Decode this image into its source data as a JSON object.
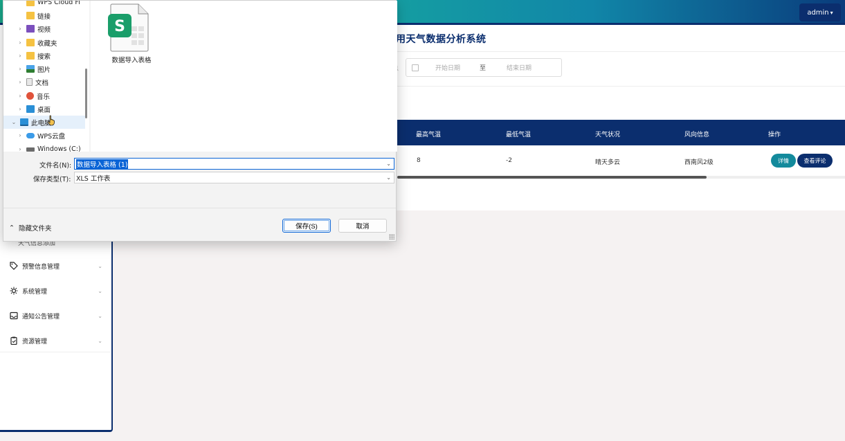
{
  "app": {
    "title": "用天气数据分析系统",
    "user_menu": "admin"
  },
  "sidebar": {
    "partial_item": "天气信息添加",
    "items": [
      {
        "label": "预警信息管理",
        "icon": "tag-icon"
      },
      {
        "label": "系统管理",
        "icon": "gear-icon"
      },
      {
        "label": "通知公告管理",
        "icon": "inbox-icon"
      },
      {
        "label": "资源管理",
        "icon": "clipboard-icon"
      }
    ]
  },
  "filter": {
    "prefix_fragment": "息",
    "start_placeholder": "开始日期",
    "separator": "至",
    "end_placeholder": "结束日期"
  },
  "table": {
    "headers": [
      "最高气温",
      "最低气温",
      "天气状况",
      "风向信息",
      "操作"
    ],
    "rows": [
      {
        "max_temp": "8",
        "min_temp": "-2",
        "condition": "晴天多云",
        "wind": "西南风2级",
        "detail_btn": "详情",
        "review_btn": "查看评论"
      }
    ]
  },
  "dialog": {
    "nav_items": [
      {
        "label": "WPS Cloud Fi",
        "icon": "folder-icon",
        "expandable": false
      },
      {
        "label": "链接",
        "icon": "folder-icon",
        "expandable": false
      },
      {
        "label": "视频",
        "icon": "video-icon",
        "expandable": true
      },
      {
        "label": "收藏夹",
        "icon": "folder-icon",
        "expandable": true
      },
      {
        "label": "搜索",
        "icon": "folder-icon",
        "expandable": true
      },
      {
        "label": "图片",
        "icon": "picture-icon",
        "expandable": true
      },
      {
        "label": "文档",
        "icon": "document-icon",
        "expandable": true
      },
      {
        "label": "音乐",
        "icon": "music-icon",
        "expandable": true
      },
      {
        "label": "桌面",
        "icon": "desktop-icon",
        "expandable": true
      },
      {
        "label": "此电脑",
        "icon": "computer-icon",
        "expandable": true,
        "expanded": true,
        "selected": true
      },
      {
        "label": "WPS云盘",
        "icon": "cloud-icon",
        "expandable": true
      },
      {
        "label": "Windows (C:)",
        "icon": "drive-icon",
        "expandable": true
      }
    ],
    "file": {
      "name": "数据导入表格",
      "icon": "spreadsheet-icon",
      "icon_letter": "S"
    },
    "filename_label": "文件名(N):",
    "filename_value": "数据导入表格 (1)",
    "filetype_label": "保存类型(T):",
    "filetype_value": "XLS 工作表",
    "hide_folders": "隐藏文件夹",
    "save_button": "保存(S)",
    "cancel_button": "取消"
  },
  "colors": {
    "brand_dark": "#0b2e6e",
    "header_gradient_start": "#1aa88a",
    "detail_button": "#138a9c",
    "selection_blue": "#0a64d6"
  }
}
